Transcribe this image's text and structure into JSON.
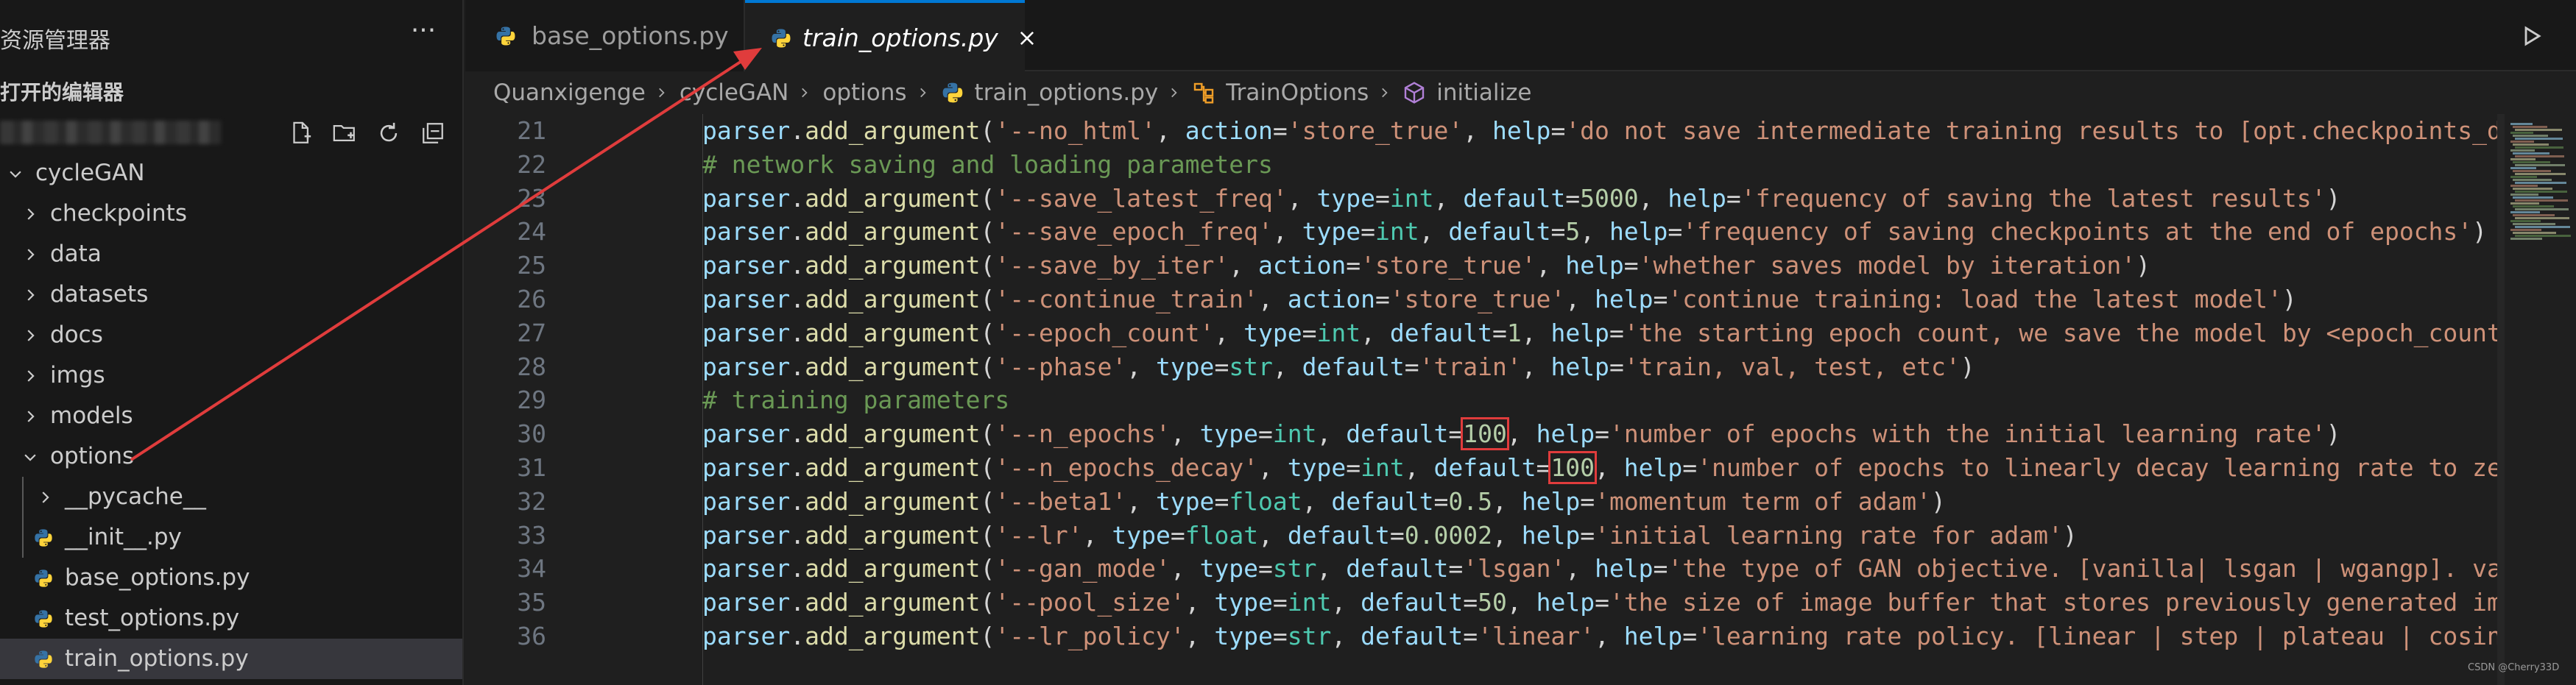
{
  "sidebar": {
    "title": "资源管理器",
    "more_label": "···",
    "open_editors": "打开的编辑器",
    "tree": [
      {
        "label": "cycleGAN",
        "kind": "folder",
        "expanded": true,
        "depth": 0
      },
      {
        "label": "checkpoints",
        "kind": "folder",
        "expanded": false,
        "depth": 1
      },
      {
        "label": "data",
        "kind": "folder",
        "expanded": false,
        "depth": 1
      },
      {
        "label": "datasets",
        "kind": "folder",
        "expanded": false,
        "depth": 1
      },
      {
        "label": "docs",
        "kind": "folder",
        "expanded": false,
        "depth": 1
      },
      {
        "label": "imgs",
        "kind": "folder",
        "expanded": false,
        "depth": 1
      },
      {
        "label": "models",
        "kind": "folder",
        "expanded": false,
        "depth": 1
      },
      {
        "label": "options",
        "kind": "folder",
        "expanded": true,
        "depth": 1
      },
      {
        "label": "__pycache__",
        "kind": "folder",
        "expanded": false,
        "depth": 2
      },
      {
        "label": "__init__.py",
        "kind": "python",
        "depth": 2
      },
      {
        "label": "base_options.py",
        "kind": "python",
        "depth": 2
      },
      {
        "label": "test_options.py",
        "kind": "python",
        "depth": 2
      },
      {
        "label": "train_options.py",
        "kind": "python",
        "depth": 2,
        "selected": true
      }
    ]
  },
  "tabs": [
    {
      "label": "base_options.py",
      "active": false
    },
    {
      "label": "train_options.py",
      "active": true
    }
  ],
  "breadcrumb": [
    "Quanxigenge",
    "cycleGAN",
    "options",
    "train_options.py",
    "TrainOptions",
    "initialize"
  ],
  "code": {
    "lines": [
      {
        "n": "21",
        "tokens": [
          [
            "parser",
            "obj"
          ],
          [
            ".",
            "p"
          ],
          [
            "add_argument",
            "fn"
          ],
          [
            "(",
            "p"
          ],
          [
            "'--no_html'",
            "str"
          ],
          [
            ", ",
            "p"
          ],
          [
            "action",
            "obj"
          ],
          [
            "=",
            "p"
          ],
          [
            "'store_true'",
            "str"
          ],
          [
            ", ",
            "p"
          ],
          [
            "help",
            "obj"
          ],
          [
            "=",
            "p"
          ],
          [
            "'do not save intermediate training results to [opt.checkpoints_dir]/",
            "str"
          ]
        ]
      },
      {
        "n": "22",
        "tokens": [
          [
            "# network saving and loading parameters",
            "cm"
          ]
        ]
      },
      {
        "n": "23",
        "tokens": [
          [
            "parser",
            "obj"
          ],
          [
            ".",
            "p"
          ],
          [
            "add_argument",
            "fn"
          ],
          [
            "(",
            "p"
          ],
          [
            "'--save_latest_freq'",
            "str"
          ],
          [
            ", ",
            "p"
          ],
          [
            "type",
            "obj"
          ],
          [
            "=",
            "p"
          ],
          [
            "int",
            "kw"
          ],
          [
            ", ",
            "p"
          ],
          [
            "default",
            "obj"
          ],
          [
            "=",
            "p"
          ],
          [
            "5000",
            "num"
          ],
          [
            ", ",
            "p"
          ],
          [
            "help",
            "obj"
          ],
          [
            "=",
            "p"
          ],
          [
            "'frequency of saving the latest results'",
            "str"
          ],
          [
            ")",
            "p"
          ]
        ]
      },
      {
        "n": "24",
        "tokens": [
          [
            "parser",
            "obj"
          ],
          [
            ".",
            "p"
          ],
          [
            "add_argument",
            "fn"
          ],
          [
            "(",
            "p"
          ],
          [
            "'--save_epoch_freq'",
            "str"
          ],
          [
            ", ",
            "p"
          ],
          [
            "type",
            "obj"
          ],
          [
            "=",
            "p"
          ],
          [
            "int",
            "kw"
          ],
          [
            ", ",
            "p"
          ],
          [
            "default",
            "obj"
          ],
          [
            "=",
            "p"
          ],
          [
            "5",
            "num"
          ],
          [
            ", ",
            "p"
          ],
          [
            "help",
            "obj"
          ],
          [
            "=",
            "p"
          ],
          [
            "'frequency of saving checkpoints at the end of epochs'",
            "str"
          ],
          [
            ")",
            "p"
          ]
        ]
      },
      {
        "n": "25",
        "tokens": [
          [
            "parser",
            "obj"
          ],
          [
            ".",
            "p"
          ],
          [
            "add_argument",
            "fn"
          ],
          [
            "(",
            "p"
          ],
          [
            "'--save_by_iter'",
            "str"
          ],
          [
            ", ",
            "p"
          ],
          [
            "action",
            "obj"
          ],
          [
            "=",
            "p"
          ],
          [
            "'store_true'",
            "str"
          ],
          [
            ", ",
            "p"
          ],
          [
            "help",
            "obj"
          ],
          [
            "=",
            "p"
          ],
          [
            "'whether saves model by iteration'",
            "str"
          ],
          [
            ")",
            "p"
          ]
        ]
      },
      {
        "n": "26",
        "tokens": [
          [
            "parser",
            "obj"
          ],
          [
            ".",
            "p"
          ],
          [
            "add_argument",
            "fn"
          ],
          [
            "(",
            "p"
          ],
          [
            "'--continue_train'",
            "str"
          ],
          [
            ", ",
            "p"
          ],
          [
            "action",
            "obj"
          ],
          [
            "=",
            "p"
          ],
          [
            "'store_true'",
            "str"
          ],
          [
            ", ",
            "p"
          ],
          [
            "help",
            "obj"
          ],
          [
            "=",
            "p"
          ],
          [
            "'continue training: load the latest model'",
            "str"
          ],
          [
            ")",
            "p"
          ]
        ]
      },
      {
        "n": "27",
        "tokens": [
          [
            "parser",
            "obj"
          ],
          [
            ".",
            "p"
          ],
          [
            "add_argument",
            "fn"
          ],
          [
            "(",
            "p"
          ],
          [
            "'--epoch_count'",
            "str"
          ],
          [
            ", ",
            "p"
          ],
          [
            "type",
            "obj"
          ],
          [
            "=",
            "p"
          ],
          [
            "int",
            "kw"
          ],
          [
            ", ",
            "p"
          ],
          [
            "default",
            "obj"
          ],
          [
            "=",
            "p"
          ],
          [
            "1",
            "num"
          ],
          [
            ", ",
            "p"
          ],
          [
            "help",
            "obj"
          ],
          [
            "=",
            "p"
          ],
          [
            "'the starting epoch count, we save the model by <epoch_count>, <",
            "str"
          ]
        ]
      },
      {
        "n": "28",
        "tokens": [
          [
            "parser",
            "obj"
          ],
          [
            ".",
            "p"
          ],
          [
            "add_argument",
            "fn"
          ],
          [
            "(",
            "p"
          ],
          [
            "'--phase'",
            "str"
          ],
          [
            ", ",
            "p"
          ],
          [
            "type",
            "obj"
          ],
          [
            "=",
            "p"
          ],
          [
            "str",
            "kw"
          ],
          [
            ", ",
            "p"
          ],
          [
            "default",
            "obj"
          ],
          [
            "=",
            "p"
          ],
          [
            "'train'",
            "str"
          ],
          [
            ", ",
            "p"
          ],
          [
            "help",
            "obj"
          ],
          [
            "=",
            "p"
          ],
          [
            "'train, val, test, etc'",
            "str"
          ],
          [
            ")",
            "p"
          ]
        ]
      },
      {
        "n": "29",
        "tokens": [
          [
            "# training parameters",
            "cm"
          ]
        ]
      },
      {
        "n": "30",
        "tokens": [
          [
            "parser",
            "obj"
          ],
          [
            ".",
            "p"
          ],
          [
            "add_argument",
            "fn"
          ],
          [
            "(",
            "p"
          ],
          [
            "'--n_epochs'",
            "str"
          ],
          [
            ", ",
            "p"
          ],
          [
            "type",
            "obj"
          ],
          [
            "=",
            "p"
          ],
          [
            "int",
            "kw"
          ],
          [
            ", ",
            "p"
          ],
          [
            "default",
            "obj"
          ],
          [
            "=",
            "p"
          ],
          [
            "100",
            "num-hl"
          ],
          [
            ", ",
            "p"
          ],
          [
            "help",
            "obj"
          ],
          [
            "=",
            "p"
          ],
          [
            "'number of epochs with the initial learning rate'",
            "str"
          ],
          [
            ")",
            "p"
          ]
        ]
      },
      {
        "n": "31",
        "tokens": [
          [
            "parser",
            "obj"
          ],
          [
            ".",
            "p"
          ],
          [
            "add_argument",
            "fn"
          ],
          [
            "(",
            "p"
          ],
          [
            "'--n_epochs_decay'",
            "str"
          ],
          [
            ", ",
            "p"
          ],
          [
            "type",
            "obj"
          ],
          [
            "=",
            "p"
          ],
          [
            "int",
            "kw"
          ],
          [
            ", ",
            "p"
          ],
          [
            "default",
            "obj"
          ],
          [
            "=",
            "p"
          ],
          [
            "100",
            "num-hl"
          ],
          [
            ", ",
            "p"
          ],
          [
            "help",
            "obj"
          ],
          [
            "=",
            "p"
          ],
          [
            "'number of epochs to linearly decay learning rate to zero'",
            "str"
          ],
          [
            ")",
            "p"
          ]
        ]
      },
      {
        "n": "32",
        "tokens": [
          [
            "parser",
            "obj"
          ],
          [
            ".",
            "p"
          ],
          [
            "add_argument",
            "fn"
          ],
          [
            "(",
            "p"
          ],
          [
            "'--beta1'",
            "str"
          ],
          [
            ", ",
            "p"
          ],
          [
            "type",
            "obj"
          ],
          [
            "=",
            "p"
          ],
          [
            "float",
            "kw"
          ],
          [
            ", ",
            "p"
          ],
          [
            "default",
            "obj"
          ],
          [
            "=",
            "p"
          ],
          [
            "0.5",
            "num"
          ],
          [
            ", ",
            "p"
          ],
          [
            "help",
            "obj"
          ],
          [
            "=",
            "p"
          ],
          [
            "'momentum term of adam'",
            "str"
          ],
          [
            ")",
            "p"
          ]
        ]
      },
      {
        "n": "33",
        "tokens": [
          [
            "parser",
            "obj"
          ],
          [
            ".",
            "p"
          ],
          [
            "add_argument",
            "fn"
          ],
          [
            "(",
            "p"
          ],
          [
            "'--lr'",
            "str"
          ],
          [
            ", ",
            "p"
          ],
          [
            "type",
            "obj"
          ],
          [
            "=",
            "p"
          ],
          [
            "float",
            "kw"
          ],
          [
            ", ",
            "p"
          ],
          [
            "default",
            "obj"
          ],
          [
            "=",
            "p"
          ],
          [
            "0.0002",
            "num"
          ],
          [
            ", ",
            "p"
          ],
          [
            "help",
            "obj"
          ],
          [
            "=",
            "p"
          ],
          [
            "'initial learning rate for adam'",
            "str"
          ],
          [
            ")",
            "p"
          ]
        ]
      },
      {
        "n": "34",
        "tokens": [
          [
            "parser",
            "obj"
          ],
          [
            ".",
            "p"
          ],
          [
            "add_argument",
            "fn"
          ],
          [
            "(",
            "p"
          ],
          [
            "'--gan_mode'",
            "str"
          ],
          [
            ", ",
            "p"
          ],
          [
            "type",
            "obj"
          ],
          [
            "=",
            "p"
          ],
          [
            "str",
            "kw"
          ],
          [
            ", ",
            "p"
          ],
          [
            "default",
            "obj"
          ],
          [
            "=",
            "p"
          ],
          [
            "'lsgan'",
            "str"
          ],
          [
            ", ",
            "p"
          ],
          [
            "help",
            "obj"
          ],
          [
            "=",
            "p"
          ],
          [
            "'the type of GAN objective. [vanilla| lsgan | wgangp]. vanil",
            "str"
          ]
        ]
      },
      {
        "n": "35",
        "tokens": [
          [
            "parser",
            "obj"
          ],
          [
            ".",
            "p"
          ],
          [
            "add_argument",
            "fn"
          ],
          [
            "(",
            "p"
          ],
          [
            "'--pool_size'",
            "str"
          ],
          [
            ", ",
            "p"
          ],
          [
            "type",
            "obj"
          ],
          [
            "=",
            "p"
          ],
          [
            "int",
            "kw"
          ],
          [
            ", ",
            "p"
          ],
          [
            "default",
            "obj"
          ],
          [
            "=",
            "p"
          ],
          [
            "50",
            "num"
          ],
          [
            ", ",
            "p"
          ],
          [
            "help",
            "obj"
          ],
          [
            "=",
            "p"
          ],
          [
            "'the size of image buffer that stores previously generated images",
            "str"
          ]
        ]
      },
      {
        "n": "36",
        "tokens": [
          [
            "parser",
            "obj"
          ],
          [
            ".",
            "p"
          ],
          [
            "add_argument",
            "fn"
          ],
          [
            "(",
            "p"
          ],
          [
            "'--lr_policy'",
            "str"
          ],
          [
            ", ",
            "p"
          ],
          [
            "type",
            "obj"
          ],
          [
            "=",
            "p"
          ],
          [
            "str",
            "kw"
          ],
          [
            ", ",
            "p"
          ],
          [
            "default",
            "obj"
          ],
          [
            "=",
            "p"
          ],
          [
            "'linear'",
            "str"
          ],
          [
            ", ",
            "p"
          ],
          [
            "help",
            "obj"
          ],
          [
            "=",
            "p"
          ],
          [
            "'learning rate policy. [linear | step | plateau | cosine]'",
            "str"
          ]
        ]
      }
    ]
  },
  "watermark": "CSDN @Cherry33D",
  "colors": {
    "accent": "#0078d4",
    "python_blue": "#3572a5",
    "python_yellow": "#ffd43b",
    "annotation": "#e03c3c"
  }
}
